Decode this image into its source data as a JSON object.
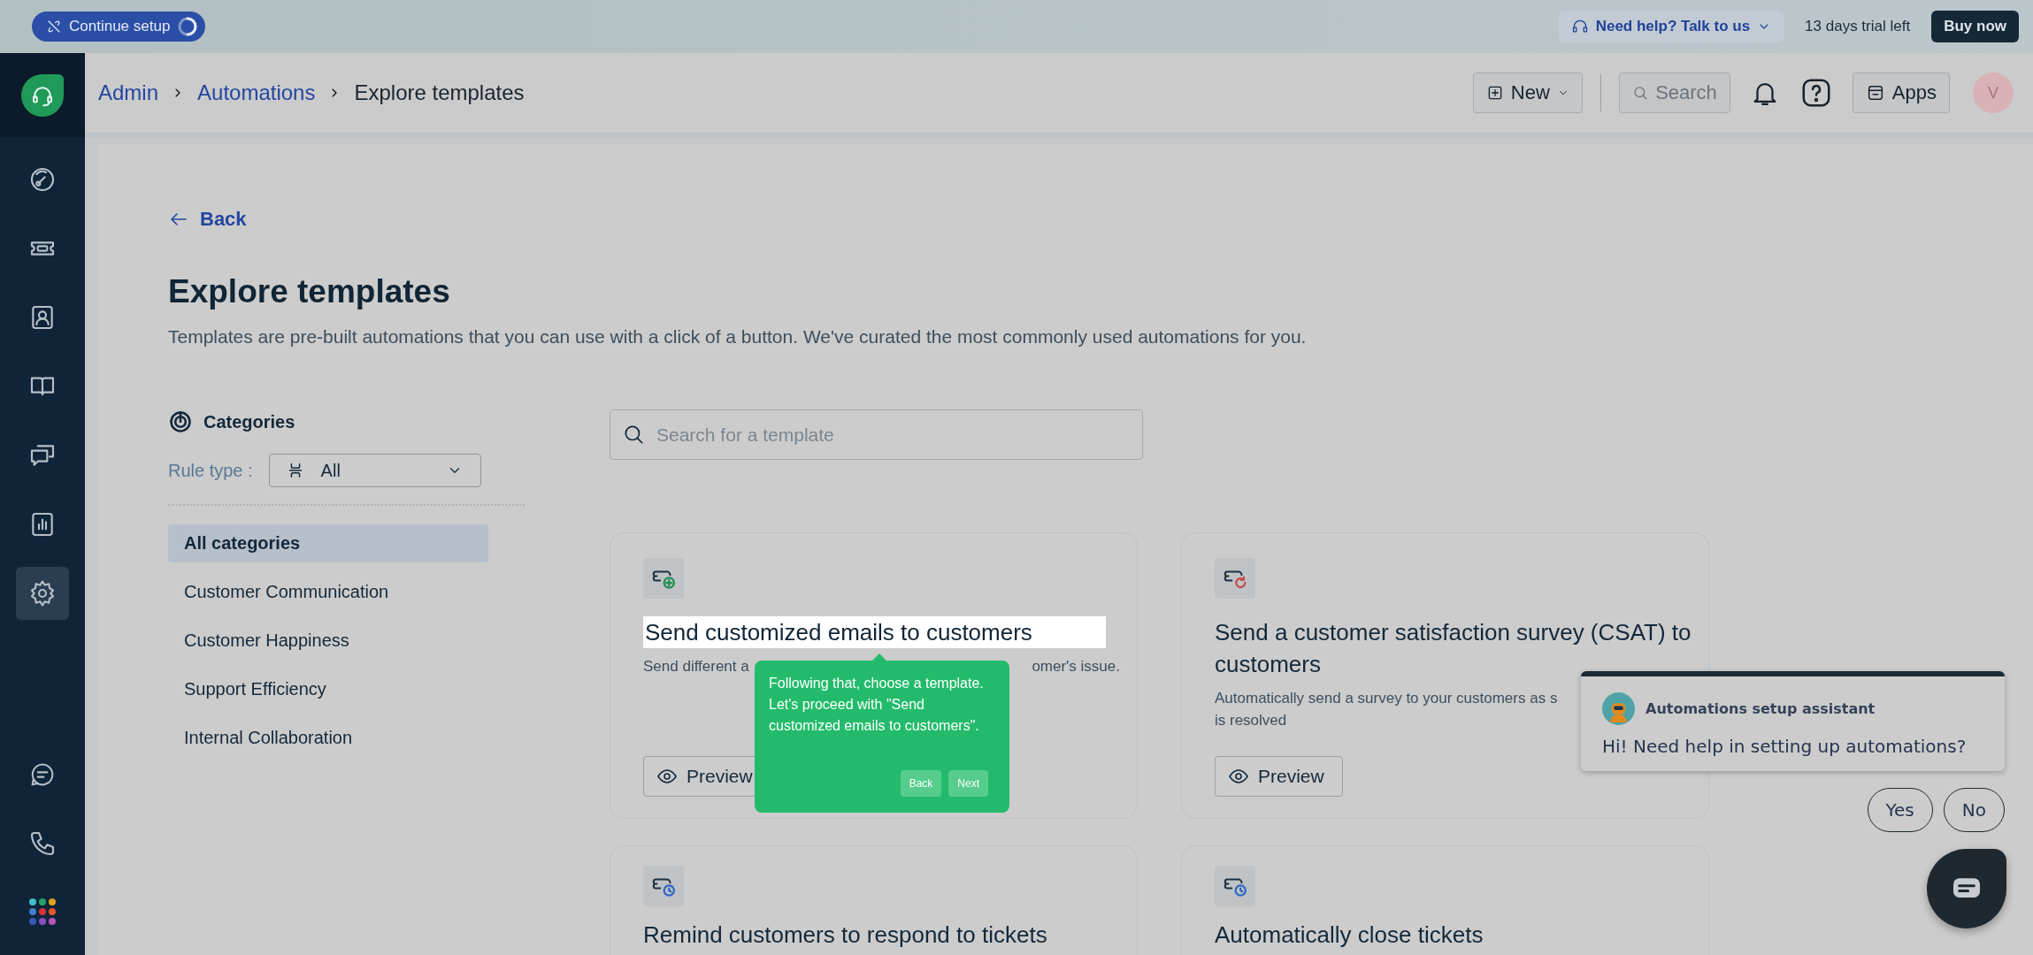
{
  "top_bar": {
    "setup_button": "Continue setup",
    "help_button": "Need help? Talk to us",
    "trial": "13 days trial left",
    "buy_button": "Buy now"
  },
  "sidebar": {
    "items": [
      {
        "kind": "dashboard",
        "selected": false
      },
      {
        "kind": "tickets",
        "selected": false
      },
      {
        "kind": "contacts",
        "selected": false
      },
      {
        "kind": "knowledge",
        "selected": false
      },
      {
        "kind": "conversations",
        "selected": false
      },
      {
        "kind": "reports",
        "selected": false
      },
      {
        "kind": "settings",
        "selected": true
      }
    ],
    "bottom_items": [
      {
        "kind": "chat"
      },
      {
        "kind": "phone"
      },
      {
        "kind": "apps"
      }
    ]
  },
  "header": {
    "breadcrumbs": [
      {
        "label": "Admin",
        "link": true
      },
      {
        "label": "Automations",
        "link": true
      },
      {
        "label": "Explore templates",
        "link": false
      }
    ],
    "new_button": "New",
    "search_placeholder": "Search",
    "apps_button": "Apps",
    "avatar": "V"
  },
  "page": {
    "back": "Back",
    "title": "Explore templates",
    "subtitle": "Templates are pre-built automations that you can use with a click of a button. We've curated the most commonly used automations for you.",
    "categories": {
      "heading": "Categories",
      "rule_type_label": "Rule type :",
      "rule_type_value": "All",
      "items": [
        {
          "label": "All categories",
          "selected": true
        },
        {
          "label": "Customer Communication",
          "selected": false
        },
        {
          "label": "Customer Happiness",
          "selected": false
        },
        {
          "label": "Support Efficiency",
          "selected": false
        },
        {
          "label": "Internal Collaboration",
          "selected": false
        }
      ]
    },
    "search": {
      "placeholder": "Search for a template"
    },
    "templates": [
      {
        "kind": "add",
        "title": "Send customized emails to customers",
        "highlighted": true,
        "description_lines": [
          [
            "Send different a",
            "omer's issue."
          ]
        ],
        "preview": "Preview"
      },
      {
        "kind": "survey",
        "title": "Send a customer satisfaction survey (CSAT) to customers",
        "highlighted": false,
        "description_lines": [
          [
            "Automatically send a survey to your customers as s"
          ],
          [
            "is resolved"
          ]
        ],
        "preview": "Preview"
      },
      {
        "kind": "timer",
        "title": "Remind customers to respond to tickets",
        "highlighted": false
      },
      {
        "kind": "timer",
        "title": "Automatically close tickets",
        "highlighted": false
      }
    ]
  },
  "tour_tip": {
    "text": "Following that, choose a template. Let's proceed with \"Send customized emails to customers\".",
    "buttons": [
      "Back",
      "Next"
    ]
  },
  "assistant": {
    "name": "Automations setup assistant",
    "message": "Hi! Need help in setting up automations?",
    "replies": [
      "Yes",
      "No"
    ]
  }
}
